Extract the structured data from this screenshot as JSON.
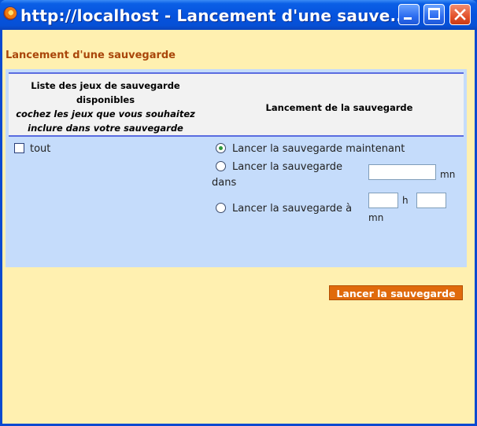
{
  "window": {
    "title": "http://localhost - Lancement d'une sauve..."
  },
  "page": {
    "heading": "Lancement d'une sauvegarde"
  },
  "table": {
    "col1_line1": "Liste des jeux de sauvegarde",
    "col1_line2": "disponibles",
    "col1_line3": "cochez les jeux que vous souhaitez",
    "col1_line4": "inclure dans votre sauvegarde",
    "col2_header": "Lancement de la sauvegarde"
  },
  "form": {
    "checkbox_all_label": "tout",
    "option_now": "Lancer la sauvegarde maintenant",
    "option_in_line1": "Lancer la sauvegarde",
    "option_in_line2": "dans",
    "unit_mn": "mn",
    "option_at": "Lancer la sauvegarde à",
    "unit_h": "h",
    "unit_mn_2": "mn",
    "delay_minutes_value": "",
    "hour_value": "",
    "minute_value": "",
    "selected_option": "now",
    "submit_label": "Lancer la sauvegarde"
  },
  "colors": {
    "titlebar": "#0553de",
    "background": "#fff0b0",
    "panel": "#c5dcfb",
    "header_rule": "#5a6ce0",
    "heading_text": "#a9460a",
    "submit_button": "#e06a0c"
  }
}
